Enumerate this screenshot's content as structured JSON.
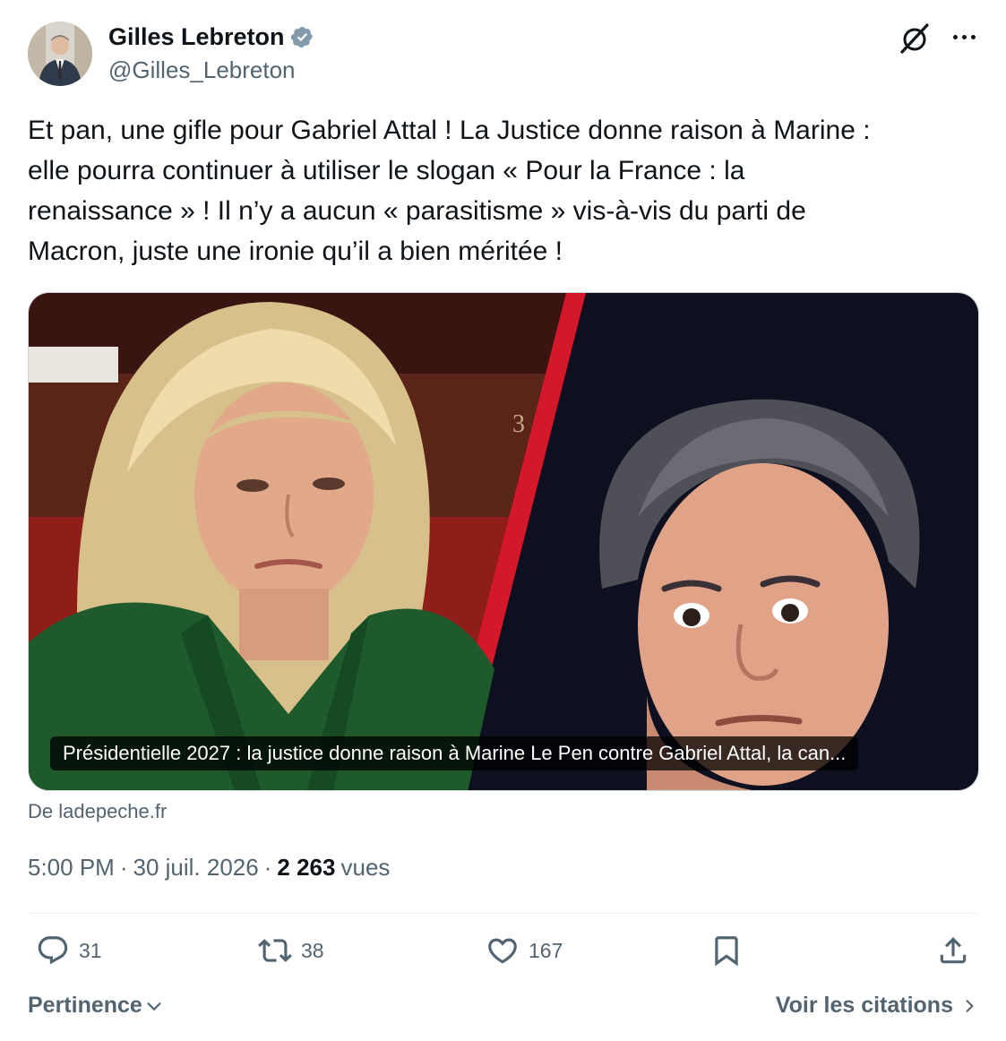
{
  "author": {
    "name": "Gilles Lebreton",
    "handle": "@Gilles_Lebreton",
    "verified_color": "#829aab"
  },
  "tweet": {
    "text": "Et pan, une gifle pour Gabriel Attal ! La Justice donne raison à Marine :\nelle pourra continuer à utiliser le slogan « Pour la France : la\nrenaissance » ! Il n’y a aucun « parasitisme » vis-à-vis du parti de\nMacron, juste une ironie qu’il a bien méritée !"
  },
  "card": {
    "caption": "Présidentielle 2027 : la justice donne raison à Marine Le Pen contre Gabriel Attal, la can...",
    "source": "De ladepeche.fr",
    "accent_color": "#d4182a"
  },
  "meta": {
    "time": "5:00 PM",
    "separator": "·",
    "date": "30 juil. 2026",
    "views_count": "2 263",
    "views_label": "vues"
  },
  "actions": {
    "replies": "31",
    "reposts": "38",
    "likes": "167"
  },
  "footer": {
    "sort_label": "Pertinence",
    "quotes_label": "Voir les citations"
  },
  "icons": [
    "verified-badge-icon",
    "grok-icon",
    "more-icon",
    "reply-icon",
    "repost-icon",
    "like-icon",
    "bookmark-icon",
    "share-icon",
    "chevron-down-icon",
    "chevron-right-icon"
  ]
}
